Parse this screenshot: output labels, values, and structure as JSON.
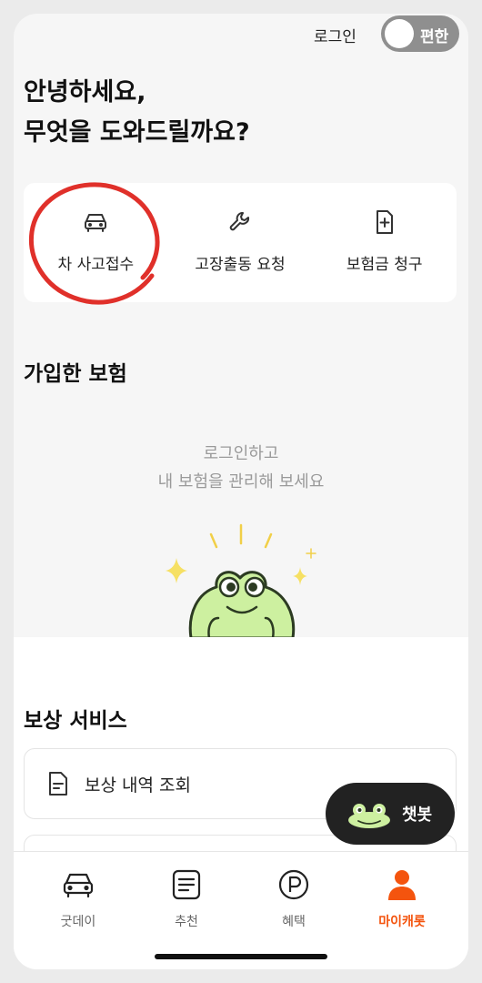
{
  "header": {
    "login_label": "로그인",
    "easy_mode_label": "편한"
  },
  "greeting": {
    "line1": "안녕하세요,",
    "line2": "무엇을 도와드릴까요?"
  },
  "quick_actions": [
    {
      "label": "차 사고접수",
      "icon": "car-icon"
    },
    {
      "label": "고장출동 요청",
      "icon": "wrench-icon"
    },
    {
      "label": "보험금 청구",
      "icon": "document-plus-icon"
    }
  ],
  "my_insurance": {
    "title": "가입한 보험",
    "prompt_line1": "로그인하고",
    "prompt_line2": "내 보험을 관리해 보세요"
  },
  "compensation": {
    "title": "보상 서비스",
    "items": [
      {
        "label": "보상 내역 조회",
        "icon": "document-icon"
      },
      {
        "label": "",
        "icon": ""
      }
    ]
  },
  "chatbot": {
    "label": "챗봇",
    "icon": "frog-icon"
  },
  "bottom_nav": [
    {
      "label": "굿데이",
      "icon": "car-icon",
      "active": false
    },
    {
      "label": "추천",
      "icon": "list-icon",
      "active": false
    },
    {
      "label": "혜택",
      "icon": "point-icon",
      "active": false
    },
    {
      "label": "마이캐롯",
      "icon": "person-icon",
      "active": true
    }
  ],
  "colors": {
    "accent": "#f4540e",
    "circle_mark": "#e0302a",
    "toggle": "#8f8f8f",
    "chatbot_bg": "#222222",
    "frog_green": "#cdf0a0"
  }
}
